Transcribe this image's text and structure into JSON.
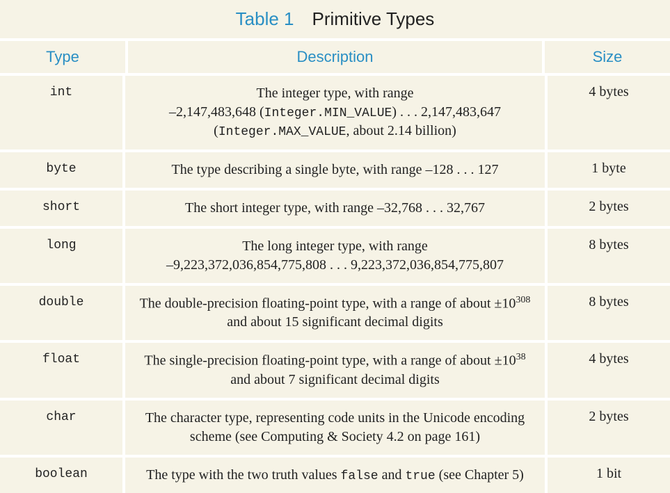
{
  "title": {
    "label": "Table 1",
    "text": "Primitive Types"
  },
  "headers": {
    "type": "Type",
    "desc": "Description",
    "size": "Size"
  },
  "rows": {
    "int": {
      "type": "int",
      "desc_line1": "The integer type, with range",
      "desc_min": "–2,147,483,648",
      "desc_min_code": "Integer.MIN_VALUE",
      "desc_dots": " . . . ",
      "desc_max": "2,147,483,647",
      "desc_max_code": "Integer.MAX_VALUE",
      "desc_note": ", about 2.14 billion)",
      "size": "4 bytes"
    },
    "byte": {
      "type": "byte",
      "desc": "The type describing a single byte, with range –128 . . . 127",
      "size": "1 byte"
    },
    "short": {
      "type": "short",
      "desc": "The short integer type, with range –32,768 . . . 32,767",
      "size": "2 bytes"
    },
    "long": {
      "type": "long",
      "desc_line1": "The long integer type, with range",
      "desc_line2": "–9,223,372,036,854,775,808 . . . 9,223,372,036,854,775,807",
      "size": "8 bytes"
    },
    "double": {
      "type": "double",
      "desc_part1": "The double-precision floating-point type, with a range of about ±10",
      "desc_exp": "308",
      "desc_part2": " and about 15 significant decimal digits",
      "size": "8 bytes"
    },
    "float": {
      "type": "float",
      "desc_part1": "The single-precision floating-point type, with a range of about ±10",
      "desc_exp": "38",
      "desc_part2": " and about 7 significant decimal digits",
      "size": "4 bytes"
    },
    "char": {
      "type": "char",
      "desc": "The character type, representing code units in the Unicode encoding scheme (see Computing & Society 4.2 on page 161)",
      "size": "2 bytes"
    },
    "boolean": {
      "type": "boolean",
      "desc_part1": "The type with the two truth values ",
      "desc_code1": "false",
      "desc_mid": " and ",
      "desc_code2": "true",
      "desc_part2": " (see Chapter 5)",
      "size": "1 bit"
    }
  }
}
